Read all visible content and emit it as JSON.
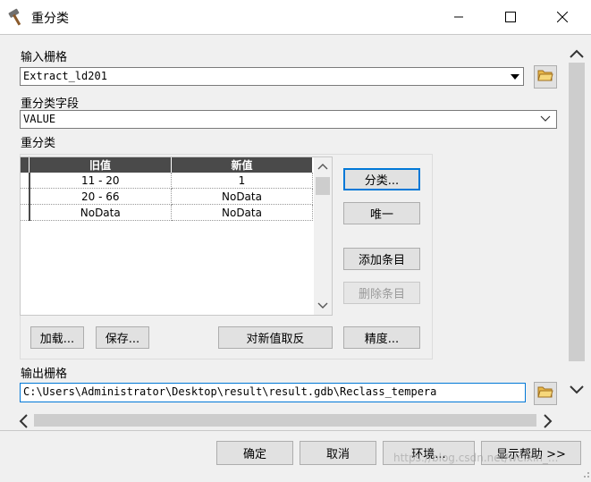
{
  "window": {
    "title": "重分类",
    "minimize_glyph": "—",
    "maximize_glyph": "☐",
    "close_glyph": "✕"
  },
  "input_raster": {
    "label": "输入栅格",
    "value": "Extract_ld201"
  },
  "reclass_field": {
    "label": "重分类字段",
    "value": "VALUE"
  },
  "reclassification": {
    "label": "重分类",
    "columns": [
      "旧值",
      "新值"
    ],
    "rows": [
      {
        "old": "11 - 20",
        "new": "1"
      },
      {
        "old": "20 - 66",
        "new": "NoData"
      },
      {
        "old": "NoData",
        "new": "NoData"
      }
    ],
    "buttons": {
      "classify": "分类...",
      "unique": "唯一",
      "add_entry": "添加条目",
      "delete_entry": "删除条目",
      "load": "加载...",
      "save": "保存...",
      "reverse": "对新值取反",
      "precision": "精度..."
    }
  },
  "output_raster": {
    "label": "输出栅格",
    "value": "C:\\Users\\Administrator\\Desktop\\result\\result.gdb\\Reclass_tempera"
  },
  "footer": {
    "ok": "确定",
    "cancel": "取消",
    "environments": "环境...",
    "show_help": "显示帮助 >>",
    "watermark": "https://blog.csdn.net/weixin_..."
  },
  "icons": {
    "title": "hammer-icon",
    "folder": "open-folder-icon"
  }
}
